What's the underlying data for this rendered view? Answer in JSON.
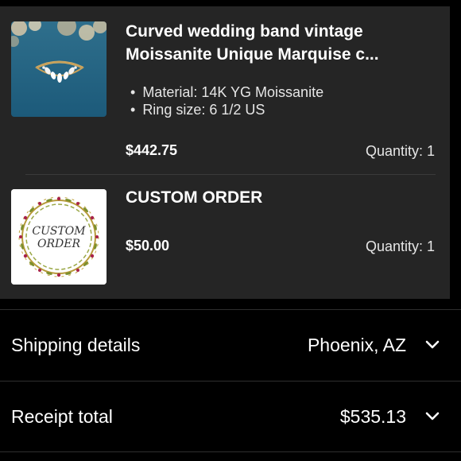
{
  "order_items": [
    {
      "title_line1": "Curved wedding band vintage",
      "title_line2": "Moissanite Unique Marquise c...",
      "specs": [
        "Material: 14K YG Moissanite",
        "Ring size: 6 1/2 US"
      ],
      "price": "$442.75",
      "quantity": "Quantity: 1"
    },
    {
      "title_line1": "CUSTOM ORDER",
      "price": "$50.00",
      "quantity": "Quantity: 1",
      "image_text_line1": "CUSTOM",
      "image_text_line2": "ORDER"
    }
  ],
  "shipping": {
    "label": "Shipping details",
    "value": "Phoenix, AZ",
    "icon": "chevron-down-icon"
  },
  "receipt": {
    "label": "Receipt total",
    "value": "$535.13",
    "icon": "chevron-down-icon"
  },
  "colors": {
    "background": "#000000",
    "card": "#252525",
    "text": "#ffffff",
    "muted": "#e6e6e6"
  }
}
